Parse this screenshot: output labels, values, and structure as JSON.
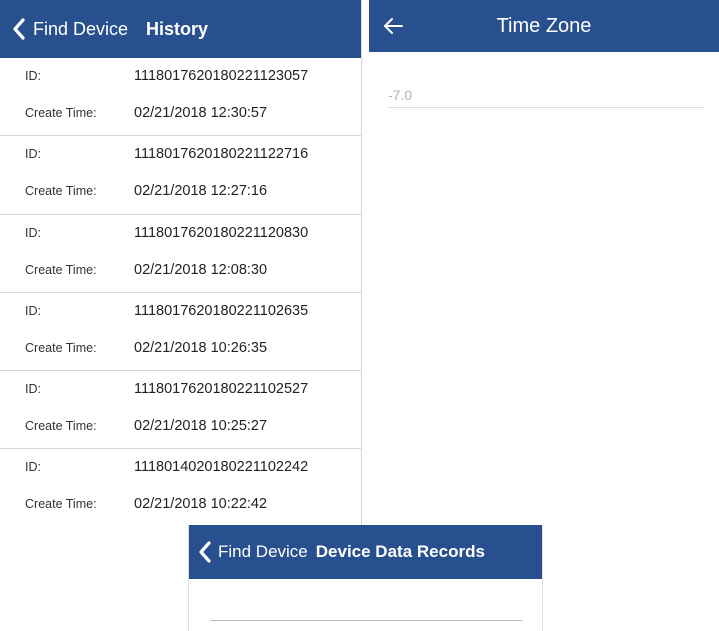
{
  "history_screen": {
    "back_label": "Find Device",
    "title": "History",
    "records": [
      {
        "id_label": "ID:",
        "id": "1118017620180221123057",
        "time_label": "Create Time:",
        "time": "02/21/2018 12:30:57"
      },
      {
        "id_label": "ID:",
        "id": "1118017620180221122716",
        "time_label": "Create Time:",
        "time": "02/21/2018 12:27:16"
      },
      {
        "id_label": "ID:",
        "id": "1118017620180221120830",
        "time_label": "Create Time:",
        "time": "02/21/2018 12:08:30"
      },
      {
        "id_label": "ID:",
        "id": "1118017620180221102635",
        "time_label": "Create Time:",
        "time": "02/21/2018 10:26:35"
      },
      {
        "id_label": "ID:",
        "id": "1118017620180221102527",
        "time_label": "Create Time:",
        "time": "02/21/2018 10:25:27"
      },
      {
        "id_label": "ID:",
        "id": "1118014020180221102242",
        "time_label": "Create Time:",
        "time": "02/21/2018 10:22:42"
      }
    ]
  },
  "timezone_screen": {
    "title": "Time Zone",
    "value": "-7.0"
  },
  "records_screen": {
    "back_label": "Find Device",
    "title": "Device Data Records"
  },
  "icons": {
    "history_back": "chevron-left-icon",
    "timezone_back": "arrow-left-icon",
    "records_back": "chevron-left-icon"
  },
  "colors": {
    "nav_bar": "#29508e",
    "nav_text": "#ffffff",
    "placeholder_text": "#b3b3b3",
    "divider": "#d9d9d9"
  }
}
